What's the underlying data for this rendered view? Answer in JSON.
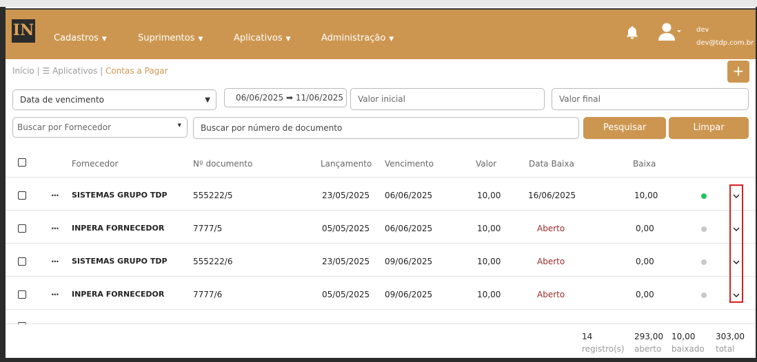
{
  "nav": {
    "logo": "IN",
    "items": [
      {
        "label": "Cadastros"
      },
      {
        "label": "Suprimentos"
      },
      {
        "label": "Aplicativos"
      },
      {
        "label": "Administração"
      }
    ],
    "user_name": "dev",
    "user_email": "dev@tdp.com.br"
  },
  "breadcrumb": {
    "home": "Início",
    "apps": "Aplicativos",
    "current": "Contas a Pagar",
    "separator": "|"
  },
  "add_button": "+",
  "filters": {
    "date_type": "Data de vencimento",
    "date_range": "06/06/2025 ➡ 11/06/2025",
    "valor_inicial_placeholder": "Valor inicial",
    "valor_final_placeholder": "Valor final",
    "fornecedor_placeholder": "Buscar por Fornecedor",
    "documento_placeholder": "Buscar por número de documento",
    "search_button": "Pesquisar",
    "clear_button": "Limpar"
  },
  "table": {
    "headers": {
      "fornecedor": "Fornecedor",
      "documento": "Nº documento",
      "lancamento": "Lançamento",
      "vencimento": "Vencimento",
      "valor": "Valor",
      "data_baixa": "Data Baixa",
      "baixa": "Baixa"
    },
    "rows": [
      {
        "fornecedor": "SISTEMAS GRUPO TDP",
        "documento": "555222/5",
        "lancamento": "23/05/2025",
        "vencimento": "06/06/2025",
        "valor": "10,00",
        "data_baixa": "16/06/2025",
        "baixa": "10,00",
        "status_color": "#22c55e"
      },
      {
        "fornecedor": "INPERA FORNECEDOR",
        "documento": "7777/5",
        "lancamento": "05/05/2025",
        "vencimento": "06/06/2025",
        "valor": "10,00",
        "data_baixa": "Aberto",
        "baixa": "0,00",
        "status_color": "#c8c8c8"
      },
      {
        "fornecedor": "SISTEMAS GRUPO TDP",
        "documento": "555222/6",
        "lancamento": "23/05/2025",
        "vencimento": "09/06/2025",
        "valor": "10,00",
        "data_baixa": "Aberto",
        "baixa": "0,00",
        "status_color": "#c8c8c8"
      },
      {
        "fornecedor": "INPERA FORNECEDOR",
        "documento": "7777/6",
        "lancamento": "05/05/2025",
        "vencimento": "09/06/2025",
        "valor": "10,00",
        "data_baixa": "Aberto",
        "baixa": "0,00",
        "status_color": "#c8c8c8"
      }
    ],
    "row_menu": "···"
  },
  "footer": {
    "registros": {
      "value": "14",
      "label": "registro(s)"
    },
    "aberto": {
      "value": "293,00",
      "label": "aberto"
    },
    "baixado": {
      "value": "10,00",
      "label": "baixado"
    },
    "total": {
      "value": "303,00",
      "label": "total"
    }
  },
  "colors": {
    "brand": "#cd9650",
    "open_text": "#9c2a2a",
    "highlight_box": "#d62020"
  }
}
